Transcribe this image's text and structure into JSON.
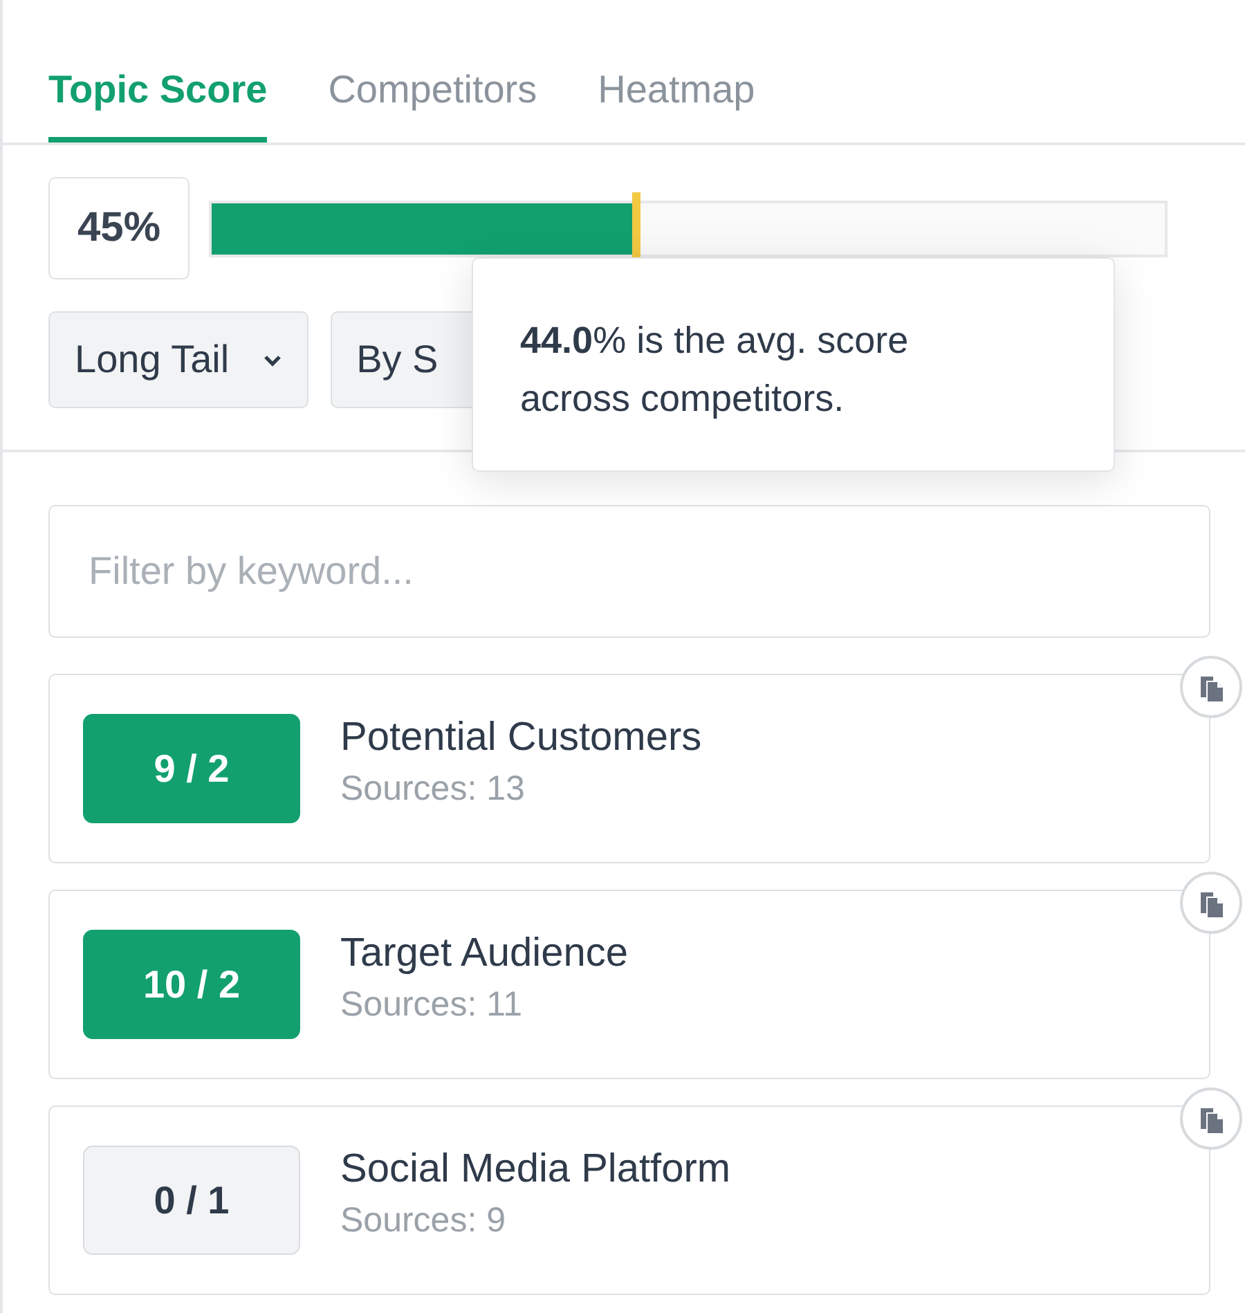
{
  "tabs": [
    {
      "label": "Topic Score",
      "selected": true
    },
    {
      "label": "Competitors",
      "selected": false
    },
    {
      "label": "Heatmap",
      "selected": false
    }
  ],
  "score": {
    "value": "45%",
    "level": 0.445,
    "marker": {
      "level": 0.445
    }
  },
  "filters": [
    {
      "label": "Long Tail",
      "caret": true
    },
    {
      "label": "By S"
    }
  ],
  "tooltip": {
    "text": "**44.0**% is the avg. score across competitors."
  },
  "search": {
    "placeholder": "Filter by keyword..."
  },
  "topics": [
    {
      "count": "9 / 2",
      "complete": true,
      "title": "Potential Customers",
      "sources": "Sources: 13"
    },
    {
      "count": "10 / 2",
      "complete": true,
      "title": "Target Audience",
      "sources": "Sources: 11"
    },
    {
      "count": "0 / 1",
      "complete": false,
      "title": "Social Media Platform",
      "sources": "Sources: 9"
    }
  ]
}
